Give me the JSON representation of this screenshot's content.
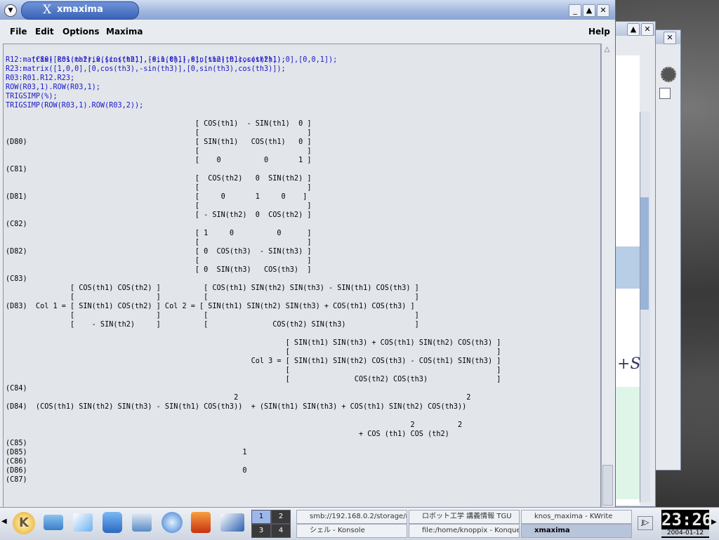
{
  "window": {
    "title": "xmaxima"
  },
  "menu": {
    "file": "File",
    "edit": "Edit",
    "options": "Options",
    "maxima": "Maxima",
    "help": "Help"
  },
  "session": {
    "input_c80": [
      "(C80) R01:matrix([cos(th1),-sin(th1),0],[sin(th1),cos(th1),0],[0,0,1]);",
      "R12:matrix([cos(th2),0,sin(th2)],[0,1,0],[-sin(th2),0,cos(th2)]);",
      "R23:matrix([1,0,0],[0,cos(th3),-sin(th3)],[0,sin(th3),cos(th3)]);",
      "R03:R01.R12.R23;",
      "ROW(R03,1).ROW(R03,1);",
      "TRIGSIMP(%);",
      "TRIGSIMP(ROW(R03,1).ROW(R03,2));"
    ],
    "output": [
      "                                            [ COS(th1)  - SIN(th1)  0 ]",
      "                                            [                         ]",
      "(D80)                                       [ SIN(th1)   COS(th1)   0 ]",
      "                                            [                         ]",
      "                                            [    0          0       1 ]",
      "(C81)",
      "                                            [  COS(th2)   0  SIN(th2) ]",
      "                                            [                         ]",
      "(D81)                                       [     0       1     0    ]",
      "                                            [                         ]",
      "                                            [ - SIN(th2)  0  COS(th2) ]",
      "(C82)",
      "                                            [ 1     0          0      ]",
      "                                            [                         ]",
      "(D82)                                       [ 0  COS(th3)  - SIN(th3) ]",
      "                                            [                         ]",
      "                                            [ 0  SIN(th3)   COS(th3)  ]",
      "(C83)",
      "               [ COS(th1) COS(th2) ]          [ COS(th1) SIN(th2) SIN(th3) - SIN(th1) COS(th3) ]",
      "               [                   ]          [                                                ]",
      "(D83)  Col 1 = [ SIN(th1) COS(th2) ] Col 2 = [ SIN(th1) SIN(th2) SIN(th3) + COS(th1) COS(th3) ]",
      "               [                   ]          [                                                ]",
      "               [    - SIN(th2)     ]          [               COS(th2) SIN(th3)                ]",
      "",
      "                                                                 [ SIN(th1) SIN(th3) + COS(th1) SIN(th2) COS(th3) ]",
      "                                                                 [                                                ]",
      "                                                         Col 3 = [ SIN(th1) SIN(th2) COS(th3) - COS(th1) SIN(th3) ]",
      "                                                                 [                                                ]",
      "                                                                 [               COS(th2) COS(th3)                ]",
      "(C84)",
      "                                                     2                                                     2",
      "(D84)  (COS(th1) SIN(th2) SIN(th3) - SIN(th1) COS(th3))  + (SIN(th1) SIN(th3) + COS(th1) SIN(th2) COS(th3))",
      "",
      "                                                                                              2          2",
      "                                                                                  + COS (th1) COS (th2)",
      "(C85)",
      "(D85)                                                  1",
      "(C86)",
      "(D86)                                                  0",
      "(C87)"
    ]
  },
  "taskbar": {
    "desktops": [
      "1",
      "2",
      "3",
      "4"
    ],
    "tasks": [
      "smb://192.168.0.2/storage/n",
      "ロボット工学 講義情報 TGU",
      "knos_maxima - KWrite",
      "シェル - Konsole",
      "file:/home/knoppix - Konquer",
      "xmaxima"
    ],
    "clock_time": "23:26",
    "clock_date": "2004-01-12"
  },
  "colors": {
    "input_text": "#1818c8",
    "title_active": "#3a63b8"
  }
}
